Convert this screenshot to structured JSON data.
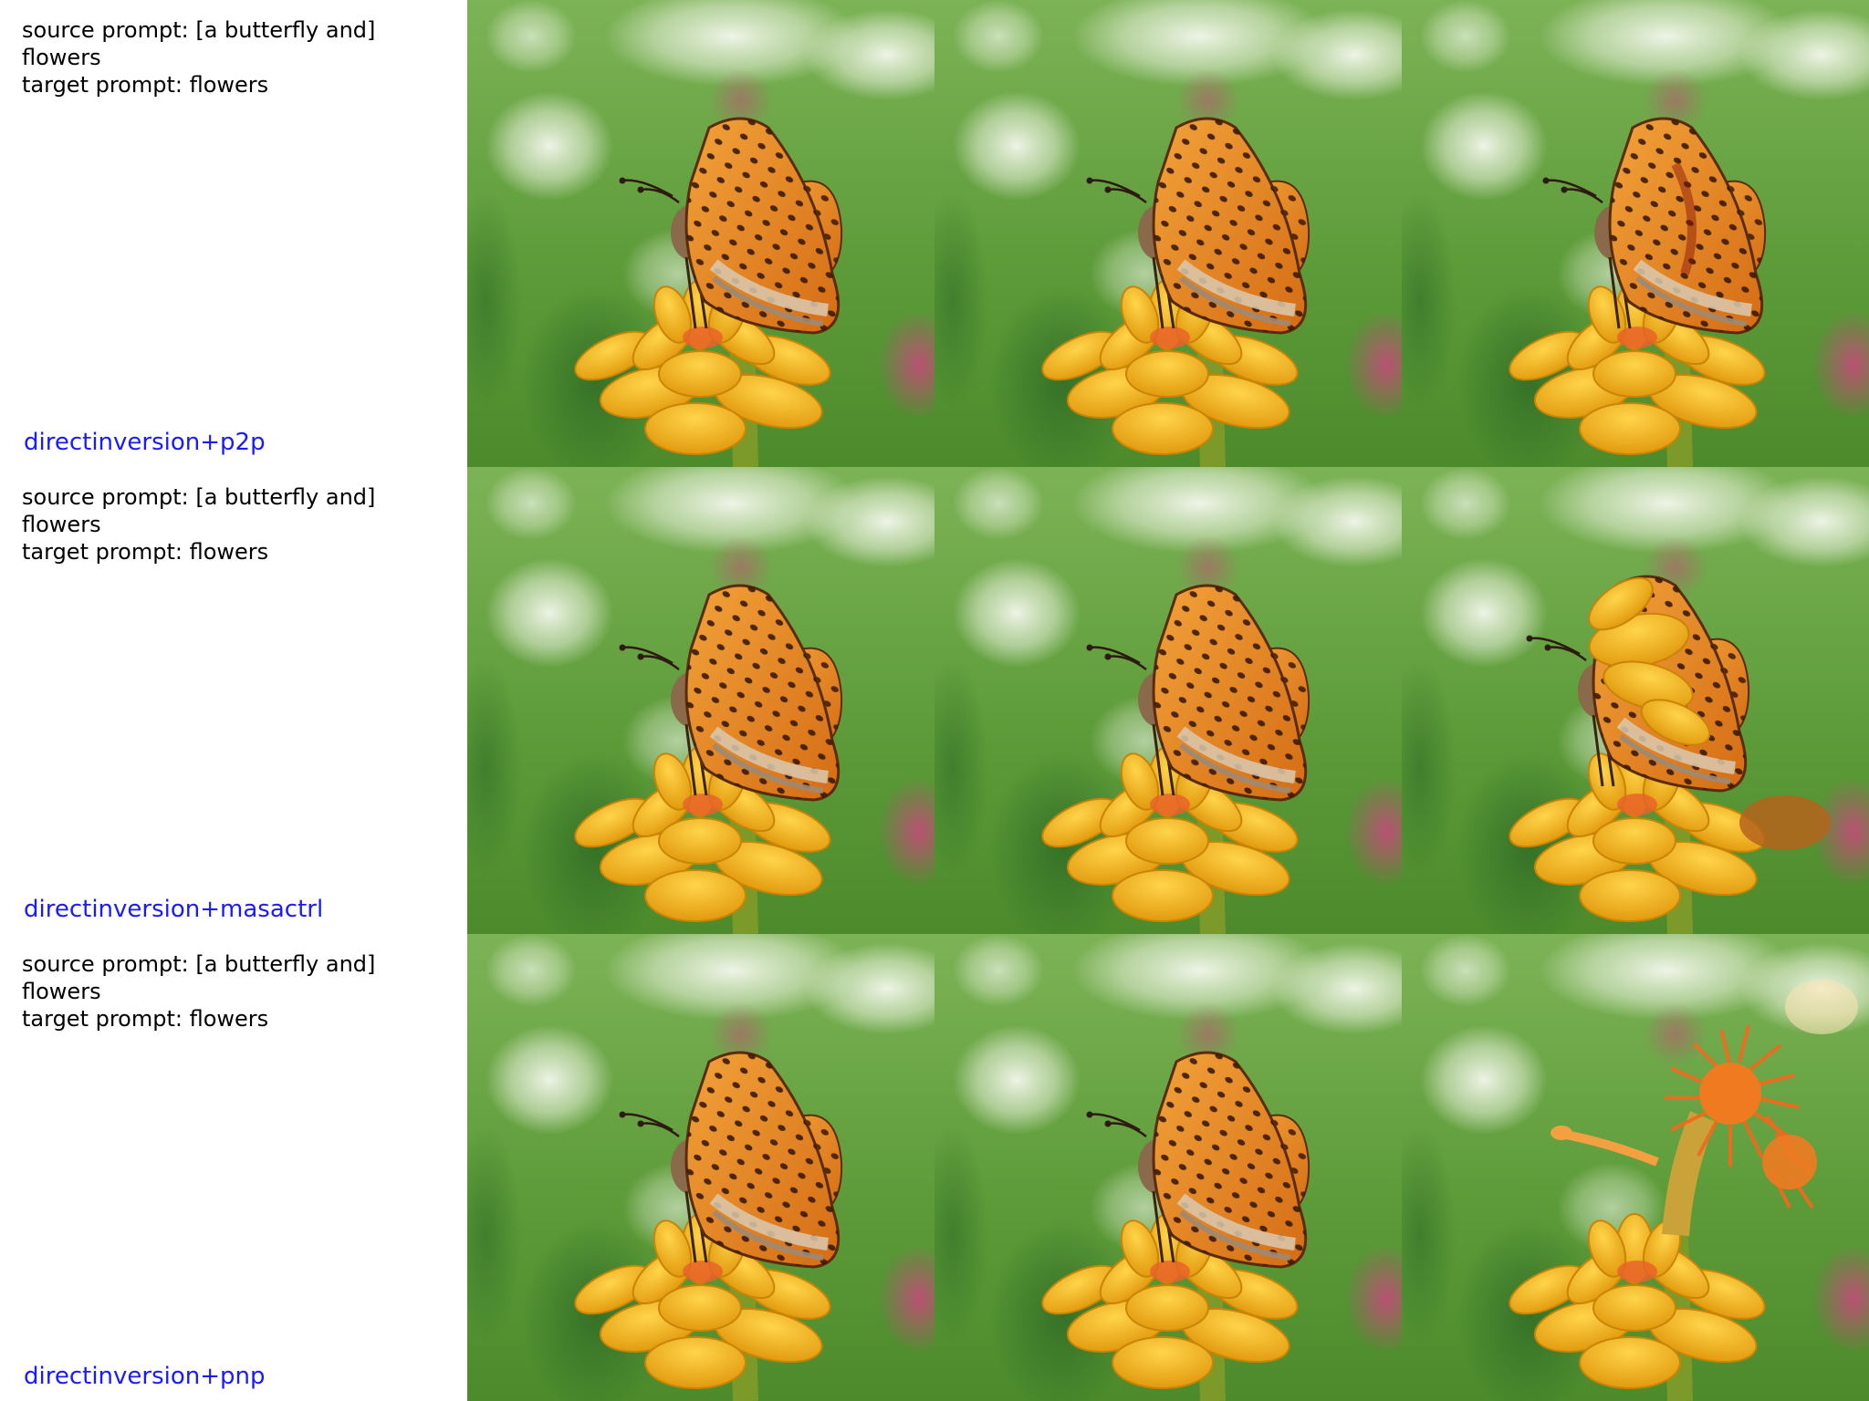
{
  "rows": [
    {
      "source_prompt": "source prompt: [a butterfly and]\nflowers",
      "target_prompt": "target prompt: flowers",
      "method": "directinversion+p2p",
      "images": [
        {
          "subject": "butterfly-on-flower",
          "variant": "original"
        },
        {
          "subject": "butterfly-on-flower",
          "variant": "reconstruction"
        },
        {
          "subject": "butterfly-on-flower",
          "variant": "edit-butterfly-kept"
        }
      ]
    },
    {
      "source_prompt": "source prompt: [a butterfly and]\nflowers",
      "target_prompt": "target prompt: flowers",
      "method": "directinversion+masactrl",
      "images": [
        {
          "subject": "butterfly-on-flower",
          "variant": "original"
        },
        {
          "subject": "butterfly-on-flower",
          "variant": "reconstruction"
        },
        {
          "subject": "butterfly-on-flower",
          "variant": "edit-butterfly-blended-into-flowers"
        }
      ]
    },
    {
      "source_prompt": "source prompt: [a butterfly and]\nflowers",
      "target_prompt": "target prompt: flowers",
      "method": "directinversion+pnp",
      "images": [
        {
          "subject": "butterfly-on-flower",
          "variant": "original"
        },
        {
          "subject": "butterfly-on-flower",
          "variant": "reconstruction"
        },
        {
          "subject": "flowers",
          "variant": "edit-butterfly-replaced-by-orange-flower"
        }
      ]
    }
  ],
  "colors": {
    "method_label": "#1a1aff",
    "prompt_text": "#000000",
    "background_green": "#5f9a3c",
    "flower_yellow": "#f2b41c",
    "butterfly_orange": "#e0821e",
    "accent_magenta": "#b23a6a"
  }
}
